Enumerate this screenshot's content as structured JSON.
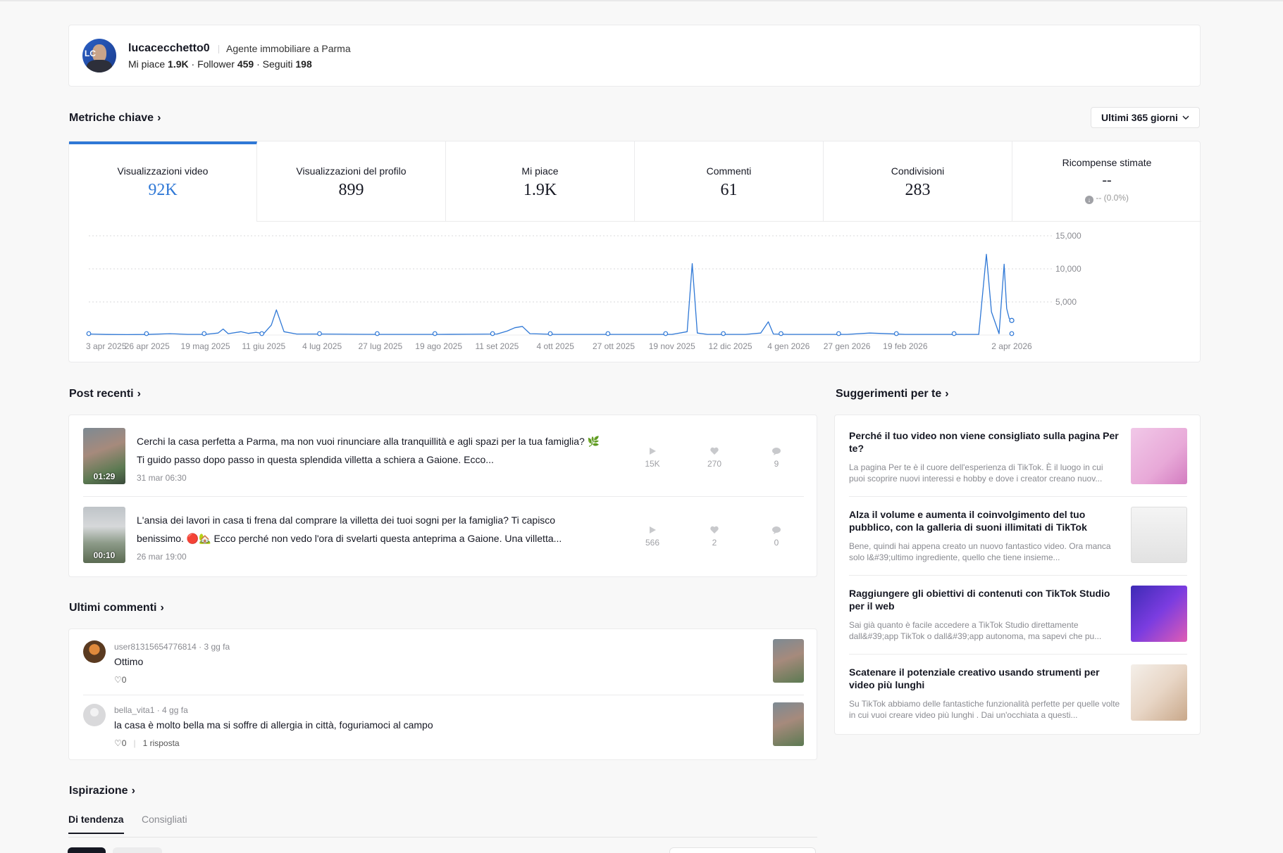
{
  "profile": {
    "username": "lucacecchetto0",
    "bio": "Agente immobiliare a Parma",
    "likes_label": "Mi piace",
    "likes": "1.9K",
    "followers_label": "Follower",
    "followers": "459",
    "following_label": "Seguiti",
    "following": "198",
    "avatar_initials": "LC"
  },
  "key_metrics": {
    "title": "Metriche chiave",
    "range": "Ultimi 365 giorni",
    "tabs": [
      {
        "label": "Visualizzazioni video",
        "value": "92K"
      },
      {
        "label": "Visualizzazioni del profilo",
        "value": "899"
      },
      {
        "label": "Mi piace",
        "value": "1.9K"
      },
      {
        "label": "Commenti",
        "value": "61"
      },
      {
        "label": "Condivisioni",
        "value": "283"
      },
      {
        "label": "Ricompense stimate",
        "value": "--",
        "sub": "-- (0.0%)"
      }
    ]
  },
  "chart_data": {
    "type": "line",
    "title": "",
    "xlabel": "",
    "ylabel": "",
    "ylim": [
      0,
      15000
    ],
    "yticks": [
      "15,000",
      "10,000",
      "5,000"
    ],
    "xticks": [
      "3 apr 2025",
      "26 apr 2025",
      "19 mag 2025",
      "11 giu 2025",
      "4 lug 2025",
      "27 lug 2025",
      "19 ago 2025",
      "11 set 2025",
      "4 ott 2025",
      "27 ott 2025",
      "19 nov 2025",
      "12 dic 2025",
      "4 gen 2026",
      "27 gen 2026",
      "19 feb 2026",
      "2 apr 2026"
    ],
    "color": "#2f78d6",
    "series": [
      {
        "x": [
          "3 apr 2025",
          "10 apr 2025",
          "18 apr 2025",
          "26 apr 2025",
          "5 mag 2025",
          "12 mag 2025",
          "19 mag 2025",
          "24 mag 2025",
          "26 mag 2025",
          "28 mag 2025",
          "2 giu 2025",
          "5 giu 2025",
          "8 giu 2025",
          "11 giu 2025",
          "14 giu 2025",
          "16 giu 2025",
          "19 giu 2025",
          "24 giu 2025",
          "4 lug 2025",
          "14 lug 2025",
          "27 lug 2025",
          "10 ago 2025",
          "19 ago 2025",
          "1 set 2025",
          "11 set 2025",
          "15 set 2025",
          "18 set 2025",
          "21 set 2025",
          "24 set 2025",
          "4 ott 2025",
          "27 ott 2025",
          "19 nov 2025",
          "25 nov 2025",
          "27 nov 2025",
          "29 nov 2025",
          "3 dic 2025",
          "12 dic 2025",
          "18 dic 2025",
          "24 dic 2025",
          "27 dic 2025",
          "29 dic 2025",
          "4 gen 2026",
          "27 gen 2026",
          "5 feb 2026",
          "19 feb 2026",
          "5 mar 2026",
          "15 mar 2026",
          "20 mar 2026",
          "23 mar 2026",
          "25 mar 2026",
          "28 mar 2026",
          "30 mar 2026",
          "31 mar 2026",
          "1 apr 2026",
          "2 apr 2026"
        ],
        "values": [
          150,
          80,
          60,
          80,
          200,
          100,
          100,
          300,
          900,
          200,
          500,
          250,
          400,
          200,
          1500,
          3800,
          500,
          150,
          150,
          120,
          100,
          100,
          100,
          120,
          150,
          600,
          1100,
          1300,
          200,
          100,
          100,
          100,
          500,
          10800,
          300,
          100,
          100,
          100,
          300,
          2000,
          150,
          100,
          100,
          300,
          100,
          100,
          100,
          100,
          12200,
          3500,
          200,
          10700,
          4000,
          2500,
          2200
        ]
      }
    ]
  },
  "recent_posts": {
    "title": "Post recenti",
    "items": [
      {
        "text": "Cerchi la casa perfetta a Parma, ma non vuoi rinunciare alla tranquillità e agli spazi per la tua famiglia? 🌿 Ti guido passo dopo passo in questa splendida villetta a schiera a Gaione. Ecco...",
        "date": "31 mar 06:30",
        "duration": "01:29",
        "views": "15K",
        "likes": "270",
        "comments": "9"
      },
      {
        "text": "L'ansia dei lavori in casa ti frena dal comprare la villetta dei tuoi sogni per la famiglia? Ti capisco benissimo. 🔴🏡 Ecco perché non vedo l'ora di svelarti questa anteprima a Gaione. Una villetta...",
        "date": "26 mar 19:00",
        "duration": "00:10",
        "views": "566",
        "likes": "2",
        "comments": "0"
      }
    ]
  },
  "suggestions": {
    "title": "Suggerimenti per te",
    "items": [
      {
        "title": "Perché il tuo video non viene consigliato sulla pagina Per te?",
        "desc": "La pagina Per te è il cuore dell'esperienza di TikTok. È il luogo in cui puoi scoprire nuovi interessi e hobby e dove i creator creano nuov..."
      },
      {
        "title": "Alza il volume e aumenta il coinvolgimento del tuo pubblico, con la galleria di suoni illimitati di TikTok",
        "desc": "Bene, quindi hai appena creato un nuovo fantastico video. Ora manca solo l&#39;ultimo ingrediente, quello che tiene insieme..."
      },
      {
        "title": "Raggiungere gli obiettivi di contenuti con TikTok Studio per il web",
        "desc": "Sai già quanto è facile accedere a TikTok Studio direttamente dall&#39;app TikTok o dall&#39;app autonoma, ma sapevi che pu..."
      },
      {
        "title": "Scatenare il potenziale creativo usando strumenti per video più lunghi",
        "desc": "Su TikTok abbiamo delle fantastiche funzionalità perfette per quelle volte in cui vuoi creare video più lunghi . Dai un'occhiata a questi..."
      }
    ]
  },
  "latest_comments": {
    "title": "Ultimi commenti",
    "items": [
      {
        "user": "user81315654776814 · 3 gg fa",
        "text": "Ottimo",
        "likes": "0",
        "replies": ""
      },
      {
        "user": "bella_vita1 · 4 gg fa",
        "text": "la casa è molto bella ma si soffre di allergia in città, foguriamoci al campo",
        "likes": "0",
        "replies": "1 risposta"
      }
    ]
  },
  "inspiration": {
    "title": "Ispirazione",
    "tabs": [
      "Di tendenza",
      "Consigliati"
    ]
  }
}
